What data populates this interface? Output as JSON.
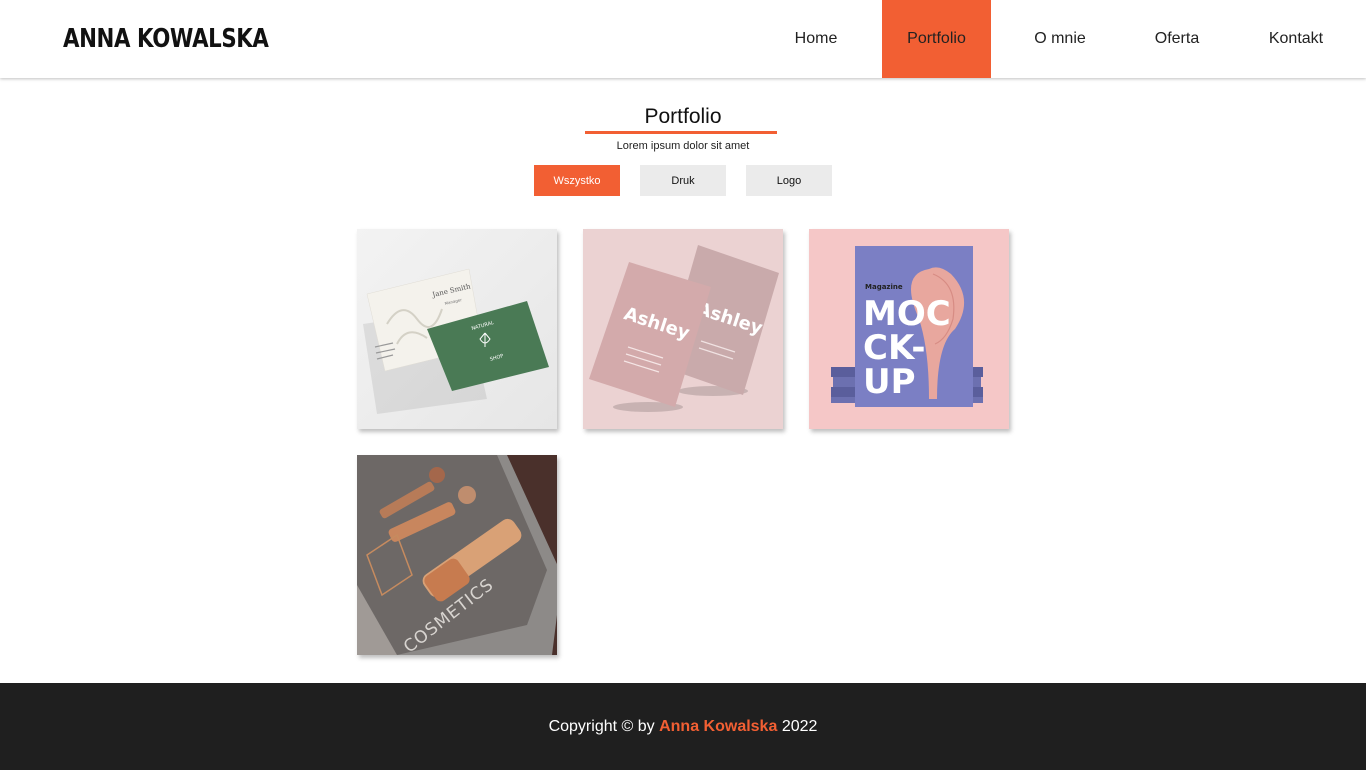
{
  "header": {
    "logo": "ANNA KOWALSKA",
    "nav": [
      {
        "label": "Home",
        "active": false
      },
      {
        "label": "Portfolio",
        "active": true
      },
      {
        "label": "O mnie",
        "active": false
      },
      {
        "label": "Oferta",
        "active": false
      },
      {
        "label": "Kontakt",
        "active": false
      }
    ]
  },
  "section": {
    "title": "Portfolio",
    "subtitle": "Lorem ipsum dolor sit amet"
  },
  "filters": [
    {
      "label": "Wszystko",
      "active": true
    },
    {
      "label": "Druk",
      "active": false
    },
    {
      "label": "Logo",
      "active": false
    }
  ],
  "portfolio": {
    "items": [
      {
        "card_name": "Jane Smith",
        "card_role": "Manager",
        "brand_top": "NATURAL",
        "brand_bottom": "SHOP"
      },
      {
        "card_text": "Ashley"
      },
      {
        "kicker": "Magazine",
        "line1": "MOC",
        "line2": "CK-",
        "line3": "UP"
      },
      {
        "cover_text": "COSMETICS"
      }
    ]
  },
  "footer": {
    "prefix": "Copyright © by",
    "name": "Anna Kowalska",
    "year": "2022"
  },
  "colors": {
    "accent": "#f25f33",
    "footer_bg": "#1f1f1f",
    "filter_bg": "#ebebeb"
  }
}
